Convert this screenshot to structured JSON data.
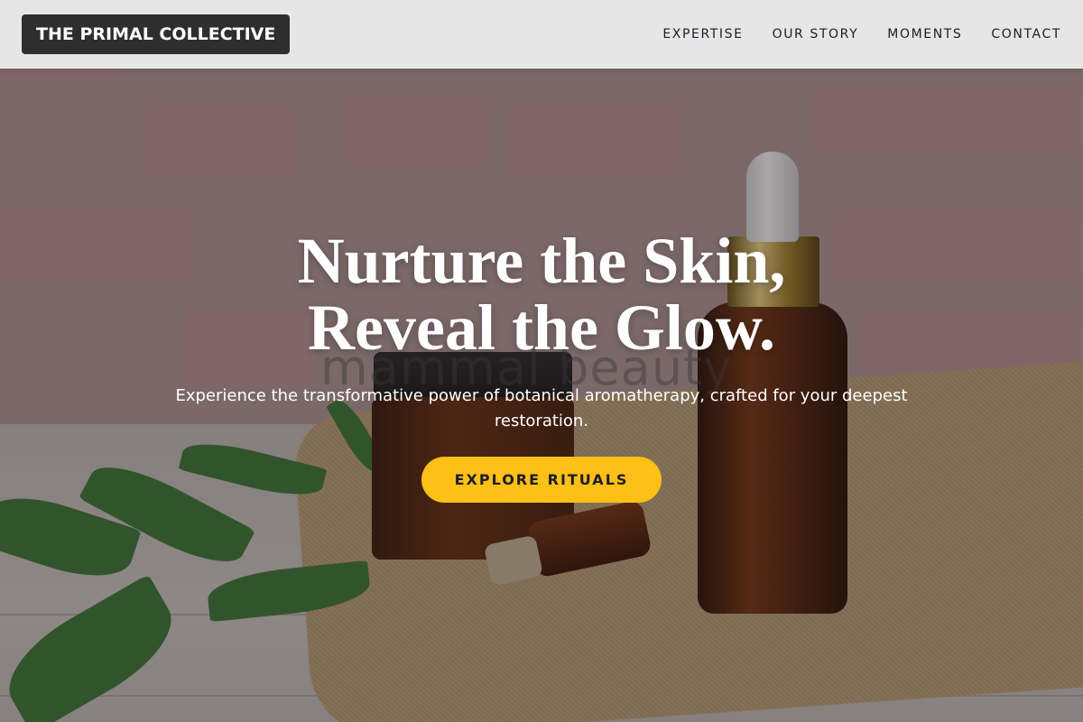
{
  "header": {
    "brand": "THE PRIMAL COLLECTIVE",
    "nav": [
      {
        "label": "EXPERTISE"
      },
      {
        "label": "OUR STORY"
      },
      {
        "label": "MOMENTS"
      },
      {
        "label": "CONTACT"
      }
    ]
  },
  "hero": {
    "title_line1": "Nurture the Skin,",
    "title_line2": "Reveal the Glow.",
    "background_watermark": "mammal beauty",
    "subtitle": "Experience the transformative power of botanical aromatherapy, crafted for your deepest restoration.",
    "cta_label": "EXPLORE RITUALS"
  },
  "colors": {
    "cta": "#fcc016",
    "brand_bg": "#2e2e2e",
    "nav_text": "#1c1c2a",
    "header_bg": "#ebebeb"
  }
}
